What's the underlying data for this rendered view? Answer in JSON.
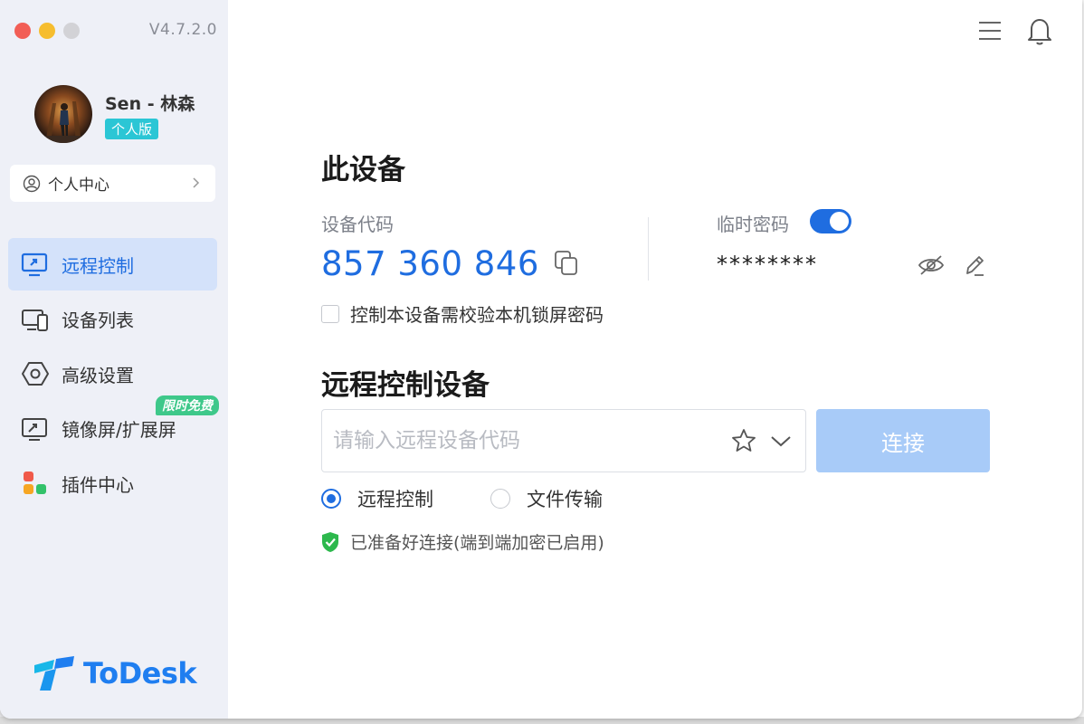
{
  "app": {
    "version": "V4.7.2.0",
    "brand": "ToDesk"
  },
  "user": {
    "name": "Sen - 林森",
    "edition": "个人版"
  },
  "sidebar": {
    "personal_center": "个人中心",
    "items": [
      {
        "label": "远程控制",
        "icon": "monitor-remote-icon",
        "active": true
      },
      {
        "label": "设备列表",
        "icon": "devices-icon"
      },
      {
        "label": "高级设置",
        "icon": "settings-hex-icon"
      },
      {
        "label": "镜像屏/扩展屏",
        "icon": "screen-mirror-icon",
        "badge": "限时免费"
      },
      {
        "label": "插件中心",
        "icon": "plugins-icon"
      }
    ]
  },
  "this_device": {
    "title": "此设备",
    "code_label": "设备代码",
    "code": "857 360 846",
    "temp_password_label": "临时密码",
    "temp_password_enabled": true,
    "temp_password": "********",
    "lock_check_label": "控制本设备需校验本机锁屏密码",
    "lock_check_checked": false
  },
  "remote": {
    "title": "远程控制设备",
    "input_placeholder": "请输入远程设备代码",
    "input_value": "",
    "connect_label": "连接",
    "modes": [
      {
        "label": "远程控制",
        "selected": true
      },
      {
        "label": "文件传输",
        "selected": false
      }
    ],
    "status": "已准备好连接(端到端加密已启用)"
  },
  "colors": {
    "accent": "#1f6de0",
    "sidebar_bg": "#eef0f7",
    "active_bg": "#d4e2fa",
    "connect_disabled": "#a8cbf8",
    "status_green": "#2db84d",
    "badge_teal": "#2bc6d5",
    "badge_green": "#3ec88a"
  }
}
